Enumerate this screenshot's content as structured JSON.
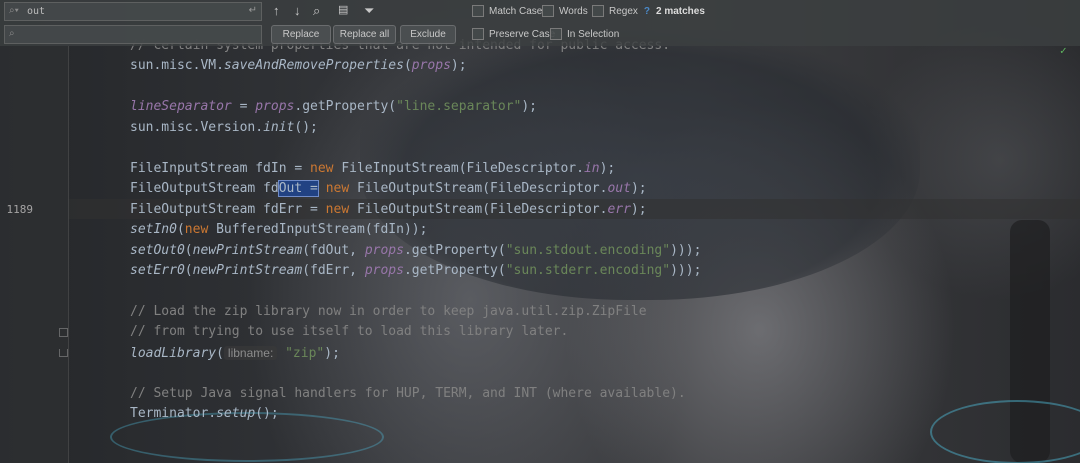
{
  "find": {
    "search_value": "out",
    "search_history_icon": "search-history-icon",
    "replace_value": "",
    "match_case_label": "Match Case",
    "match_case_checked": false,
    "words_label": "Words",
    "words_checked": false,
    "regex_label": "Regex",
    "regex_help": "?",
    "regex_checked": false,
    "matches_label": "2 matches",
    "preserve_case_label": "Preserve Case",
    "preserve_case_checked": false,
    "in_selection_label": "In Selection",
    "in_selection_checked": false,
    "replace_button": "Replace",
    "replace_all_button": "Replace all",
    "exclude_button": "Exclude"
  },
  "toolbar_icons": [
    "arrow-up-icon",
    "arrow-down-icon",
    "find-all-icon",
    "select-all-occurrences-icon",
    "filter-icon"
  ],
  "editor": {
    "current_line_number": "1189",
    "lines": [
      {
        "num": "",
        "segments": [
          {
            "t": "// certain system properties that are not intended for public access.",
            "c": "cm"
          }
        ]
      },
      {
        "num": "",
        "segments": [
          {
            "t": "sun.misc.VM.",
            "c": ""
          },
          {
            "t": "saveAndRemoveProperties",
            "c": "it"
          },
          {
            "t": "(",
            "c": ""
          },
          {
            "t": "props",
            "c": "fldi"
          },
          {
            "t": ");",
            "c": ""
          }
        ]
      },
      {
        "num": "",
        "segments": []
      },
      {
        "num": "",
        "segments": [
          {
            "t": "lineSeparator",
            "c": "fldi"
          },
          {
            "t": " = ",
            "c": ""
          },
          {
            "t": "props",
            "c": "fldi"
          },
          {
            "t": ".getProperty(",
            "c": ""
          },
          {
            "t": "\"line.separator\"",
            "c": "str"
          },
          {
            "t": ");",
            "c": ""
          }
        ]
      },
      {
        "num": "",
        "segments": [
          {
            "t": "sun.misc.Version.",
            "c": ""
          },
          {
            "t": "init",
            "c": "it"
          },
          {
            "t": "();",
            "c": ""
          }
        ]
      },
      {
        "num": "",
        "segments": []
      },
      {
        "num": "",
        "segments": [
          {
            "t": "FileInputStream fdIn = ",
            "c": ""
          },
          {
            "t": "new",
            "c": "kw"
          },
          {
            "t": " FileInputStream(FileDescriptor.",
            "c": ""
          },
          {
            "t": "in",
            "c": "fldi"
          },
          {
            "t": ");",
            "c": ""
          }
        ]
      },
      {
        "num": "1189",
        "segments": [
          {
            "t": "FileOutputStream fd",
            "c": ""
          },
          {
            "t": "Out =",
            "c": "sel"
          },
          {
            "t": " ",
            "c": ""
          },
          {
            "t": "new",
            "c": "kw"
          },
          {
            "t": " FileOutputStream(FileDescriptor.",
            "c": ""
          },
          {
            "t": "out",
            "c": "fldi"
          },
          {
            "t": ");",
            "c": ""
          }
        ]
      },
      {
        "num": "",
        "segments": [
          {
            "t": "FileOutputStream fdErr = ",
            "c": ""
          },
          {
            "t": "new",
            "c": "kw"
          },
          {
            "t": " FileOutputStream(FileDescriptor.",
            "c": ""
          },
          {
            "t": "err",
            "c": "fldi"
          },
          {
            "t": ");",
            "c": ""
          }
        ]
      },
      {
        "num": "",
        "segments": [
          {
            "t": "setIn0",
            "c": "it"
          },
          {
            "t": "(",
            "c": ""
          },
          {
            "t": "new",
            "c": "kw"
          },
          {
            "t": " BufferedInputStream(fdIn));",
            "c": ""
          }
        ]
      },
      {
        "num": "",
        "segments": [
          {
            "t": "setOut0",
            "c": "it"
          },
          {
            "t": "(",
            "c": ""
          },
          {
            "t": "newPrintStream",
            "c": "it"
          },
          {
            "t": "(fdOut, ",
            "c": ""
          },
          {
            "t": "props",
            "c": "fldi"
          },
          {
            "t": ".getProperty(",
            "c": ""
          },
          {
            "t": "\"sun.stdout.encoding\"",
            "c": "str"
          },
          {
            "t": ")));",
            "c": ""
          }
        ]
      },
      {
        "num": "",
        "segments": [
          {
            "t": "setErr0",
            "c": "it"
          },
          {
            "t": "(",
            "c": ""
          },
          {
            "t": "newPrintStream",
            "c": "it"
          },
          {
            "t": "(fdErr, ",
            "c": ""
          },
          {
            "t": "props",
            "c": "fldi"
          },
          {
            "t": ".getProperty(",
            "c": ""
          },
          {
            "t": "\"sun.stderr.encoding\"",
            "c": "str"
          },
          {
            "t": ")));",
            "c": ""
          }
        ]
      },
      {
        "num": "",
        "segments": []
      },
      {
        "num": "",
        "segments": [
          {
            "t": "// Load the zip library now in order to keep java.util.zip.ZipFile",
            "c": "cm"
          }
        ]
      },
      {
        "num": "",
        "segments": [
          {
            "t": "// from trying to use itself to load this library later.",
            "c": "cm"
          }
        ]
      },
      {
        "num": "",
        "segments": [
          {
            "t": "loadLibrary",
            "c": "it"
          },
          {
            "t": "(",
            "c": ""
          },
          {
            "t": "libname:",
            "c": "hint"
          },
          {
            "t": " ",
            "c": ""
          },
          {
            "t": "\"zip\"",
            "c": "str"
          },
          {
            "t": ");",
            "c": ""
          }
        ]
      },
      {
        "num": "",
        "segments": []
      },
      {
        "num": "",
        "segments": [
          {
            "t": "// Setup Java signal handlers for HUP, TERM, and INT (where available).",
            "c": "cm"
          }
        ]
      },
      {
        "num": "",
        "segments": [
          {
            "t": "Terminator.",
            "c": ""
          },
          {
            "t": "setup",
            "c": "it"
          },
          {
            "t": "();",
            "c": ""
          }
        ]
      }
    ]
  },
  "colors": {
    "keyword": "#cc7832",
    "string": "#6a8759",
    "field": "#9876aa",
    "comment": "#808080",
    "text": "#a9b7c6",
    "selection": "#214283"
  }
}
